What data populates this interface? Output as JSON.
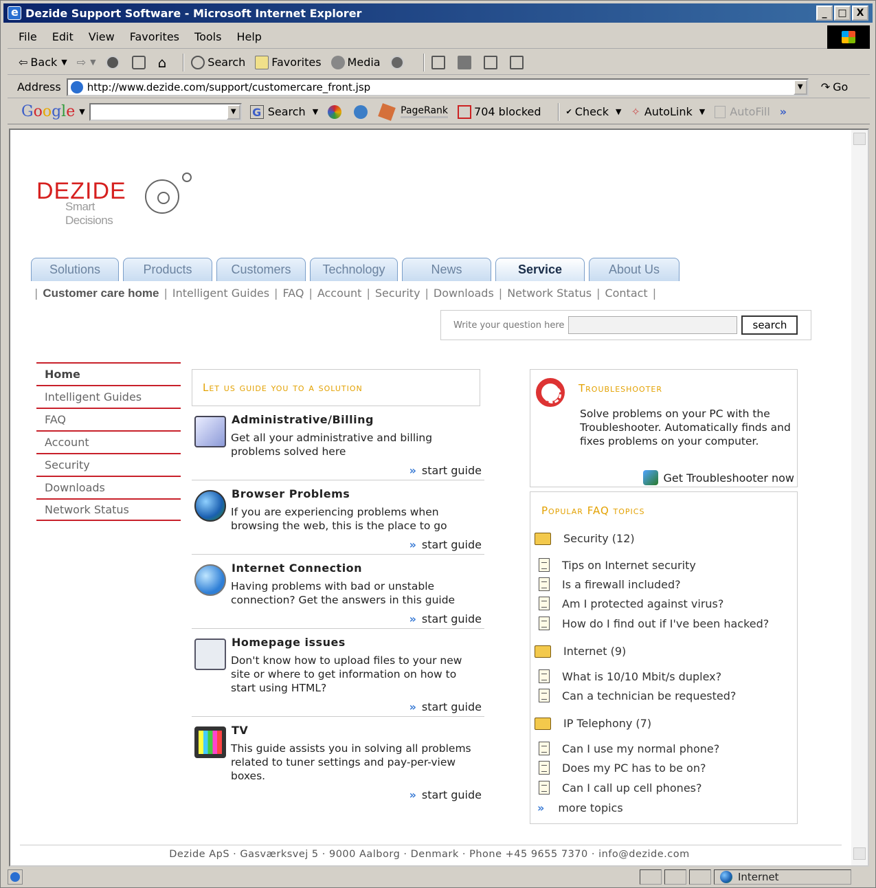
{
  "window": {
    "title": "Dezide Support Software - Microsoft Internet Explorer",
    "buttons": [
      "_",
      "□",
      "X"
    ]
  },
  "menu": [
    "File",
    "Edit",
    "View",
    "Favorites",
    "Tools",
    "Help"
  ],
  "toolbar": {
    "back": "Back",
    "search": "Search",
    "favorites": "Favorites",
    "media": "Media"
  },
  "address": {
    "label": "Address",
    "url": "http://www.dezide.com/support/customercare_front.jsp",
    "go": "Go"
  },
  "googlebar": {
    "search": "Search",
    "pagerank": "PageRank",
    "blocked": "704 blocked",
    "check": "Check",
    "autolink": "AutoLink",
    "autofill": "AutoFill",
    "more": "»"
  },
  "logo": {
    "word": "DEZIDE",
    "tagline": "Smart Decisions"
  },
  "tabs": [
    {
      "label": "Solutions",
      "active": false
    },
    {
      "label": "Products",
      "active": false
    },
    {
      "label": "Customers",
      "active": false
    },
    {
      "label": "Technology",
      "active": false
    },
    {
      "label": "News",
      "active": false
    },
    {
      "label": "Service",
      "active": true
    },
    {
      "label": "About Us",
      "active": false
    }
  ],
  "subnav": [
    "Customer care home",
    "Intelligent Guides",
    "FAQ",
    "Account",
    "Security",
    "Downloads",
    "Network Status",
    "Contact"
  ],
  "search": {
    "label": "Write your question here",
    "value": "",
    "button": "search"
  },
  "leftnav": [
    "Home",
    "Intelligent Guides",
    "FAQ",
    "Account",
    "Security",
    "Downloads",
    "Network Status"
  ],
  "guides": {
    "heading": "Let us guide you to a solution",
    "link_label": "start guide",
    "items": [
      {
        "title": "Administrative/Billing",
        "desc": "Get all your administrative and billing problems solved here",
        "icon": "billing-icon"
      },
      {
        "title": "Browser Problems",
        "desc": "If you are experiencing problems when browsing the web, this is the place to go",
        "icon": "browser-globe-icon"
      },
      {
        "title": "Internet Connection",
        "desc": "Having problems with bad or unstable connection? Get the answers in this guide",
        "icon": "connection-globe-icon"
      },
      {
        "title": "Homepage issues",
        "desc": "Don't know how to upload files to your new site or where to get information on how to start using HTML?",
        "icon": "homepage-icon"
      },
      {
        "title": "TV",
        "desc": "This guide assists you in solving all problems related to tuner settings and pay-per-view boxes.",
        "icon": "tv-icon"
      }
    ]
  },
  "troubleshooter": {
    "title": "Troubleshooter",
    "desc": "Solve problems on your PC with the Troubleshooter. Automatically finds and fixes problems on your computer.",
    "link": "Get Troubleshooter now"
  },
  "faq": {
    "title": "Popular FAQ topics",
    "categories": [
      {
        "name": "Security (12)",
        "questions": [
          "Tips on Internet security",
          "Is a firewall included?",
          "Am I protected against virus?",
          "How do I find out if I've been hacked?"
        ]
      },
      {
        "name": "Internet (9)",
        "questions": [
          "What is 10/10 Mbit/s duplex?",
          "Can a technician be requested?"
        ]
      },
      {
        "name": "IP Telephony (7)",
        "questions": [
          "Can I use my normal phone?",
          "Does my PC has to be on?",
          "Can I call up cell phones?"
        ]
      }
    ],
    "more": "more topics"
  },
  "footer": "Dezide ApS · Gasværksvej 5 · 9000 Aalborg · Denmark · Phone +45 9655 7370 · info@dezide.com",
  "status": {
    "zone": "Internet"
  }
}
